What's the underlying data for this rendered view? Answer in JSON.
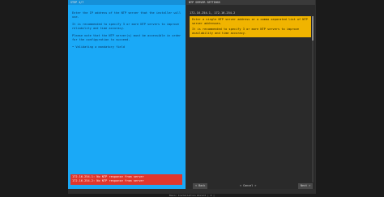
{
  "left_pane": {
    "title": "STEP 4/7",
    "help_paragraphs": [
      "Enter the IP address of the NTP server that the installer will use.",
      "It is recommended to specify 3 or more NTP servers to improve reliability and time accuracy.",
      "Please note that the NTP server(s) must be accessible in order for the configuration to succeed.",
      "• Validating a mandatory field"
    ],
    "errors": [
      "172.16.254.1: No NTP response from server",
      "172.16.254.2: No NTP response from server"
    ]
  },
  "right_pane": {
    "title": "NTP SERVER SETTINGS",
    "field_value": "172.16.254.1, 172.16.254.2",
    "info_paragraphs": [
      "Enter a single NTP server address or a comma separated list of NTP server addresses.",
      "It is recommended to specify 3 or more NTP servers to improve availability and time accuracy."
    ]
  },
  "buttons": {
    "back": "< Back",
    "cancel": "< Cancel >",
    "next": "Next >"
  },
  "statusbar": "Basic Installation Wizard | 4 |"
}
